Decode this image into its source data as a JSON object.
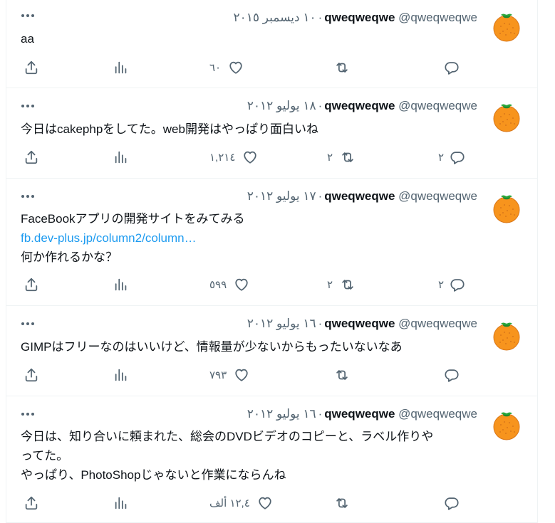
{
  "tweets": [
    {
      "name": "qweqweqwe",
      "handle": "@qweqweqwe",
      "date": "١٠ ديسمبر ٢٠١٥",
      "lines": [
        {
          "text": "aa",
          "link": false
        }
      ],
      "replies": "",
      "retweets": "",
      "likes": "٦٠"
    },
    {
      "name": "qweqweqwe",
      "handle": "@qweqweqwe",
      "date": "١٨ يوليو ٢٠١٢",
      "lines": [
        {
          "text": "今日はcakephpをしてた。web開発はやっぱり面白いね",
          "link": false
        }
      ],
      "replies": "٢",
      "retweets": "٢",
      "likes": "١,٢١٤"
    },
    {
      "name": "qweqweqwe",
      "handle": "@qweqweqwe",
      "date": "١٧ يوليو ٢٠١٢",
      "lines": [
        {
          "text": "FaceBookアプリの開発サイトをみてみる",
          "link": false
        },
        {
          "text": "fb.dev-plus.jp/column2/column…",
          "link": true
        },
        {
          "text": "何か作れるかな？",
          "link": false
        }
      ],
      "replies": "٢",
      "retweets": "٢",
      "likes": "٥٩٩"
    },
    {
      "name": "qweqweqwe",
      "handle": "@qweqweqwe",
      "date": "١٦ يوليو ٢٠١٢",
      "lines": [
        {
          "text": "GIMPはフリーなのはいいけど、情報量が少ないからもったいないなあ",
          "link": false
        }
      ],
      "replies": "",
      "retweets": "",
      "likes": "٧٩٣"
    },
    {
      "name": "qweqweqwe",
      "handle": "@qweqweqwe",
      "date": "١٦ يوليو ٢٠١٢",
      "lines": [
        {
          "text": "今日は、知り合いに頼まれた、総会のDVDビデオのコピーと、ラベル作りや",
          "link": false
        },
        {
          "text": "ってた。",
          "link": false
        },
        {
          "text": "やっぱり、PhotoShopじゃないと作業にならんね",
          "link": false
        }
      ],
      "replies": "",
      "retweets": "",
      "likes": "١٢,٤ ألف"
    }
  ],
  "colors": {
    "text": "#0f1419",
    "secondary": "#536471",
    "link": "#1d9bf0",
    "divider": "#eff3f4",
    "orange": "#f7941d"
  },
  "icons": [
    "more-icon",
    "share-icon",
    "views-icon",
    "like-icon",
    "retweet-icon",
    "reply-icon",
    "orange-avatar"
  ]
}
